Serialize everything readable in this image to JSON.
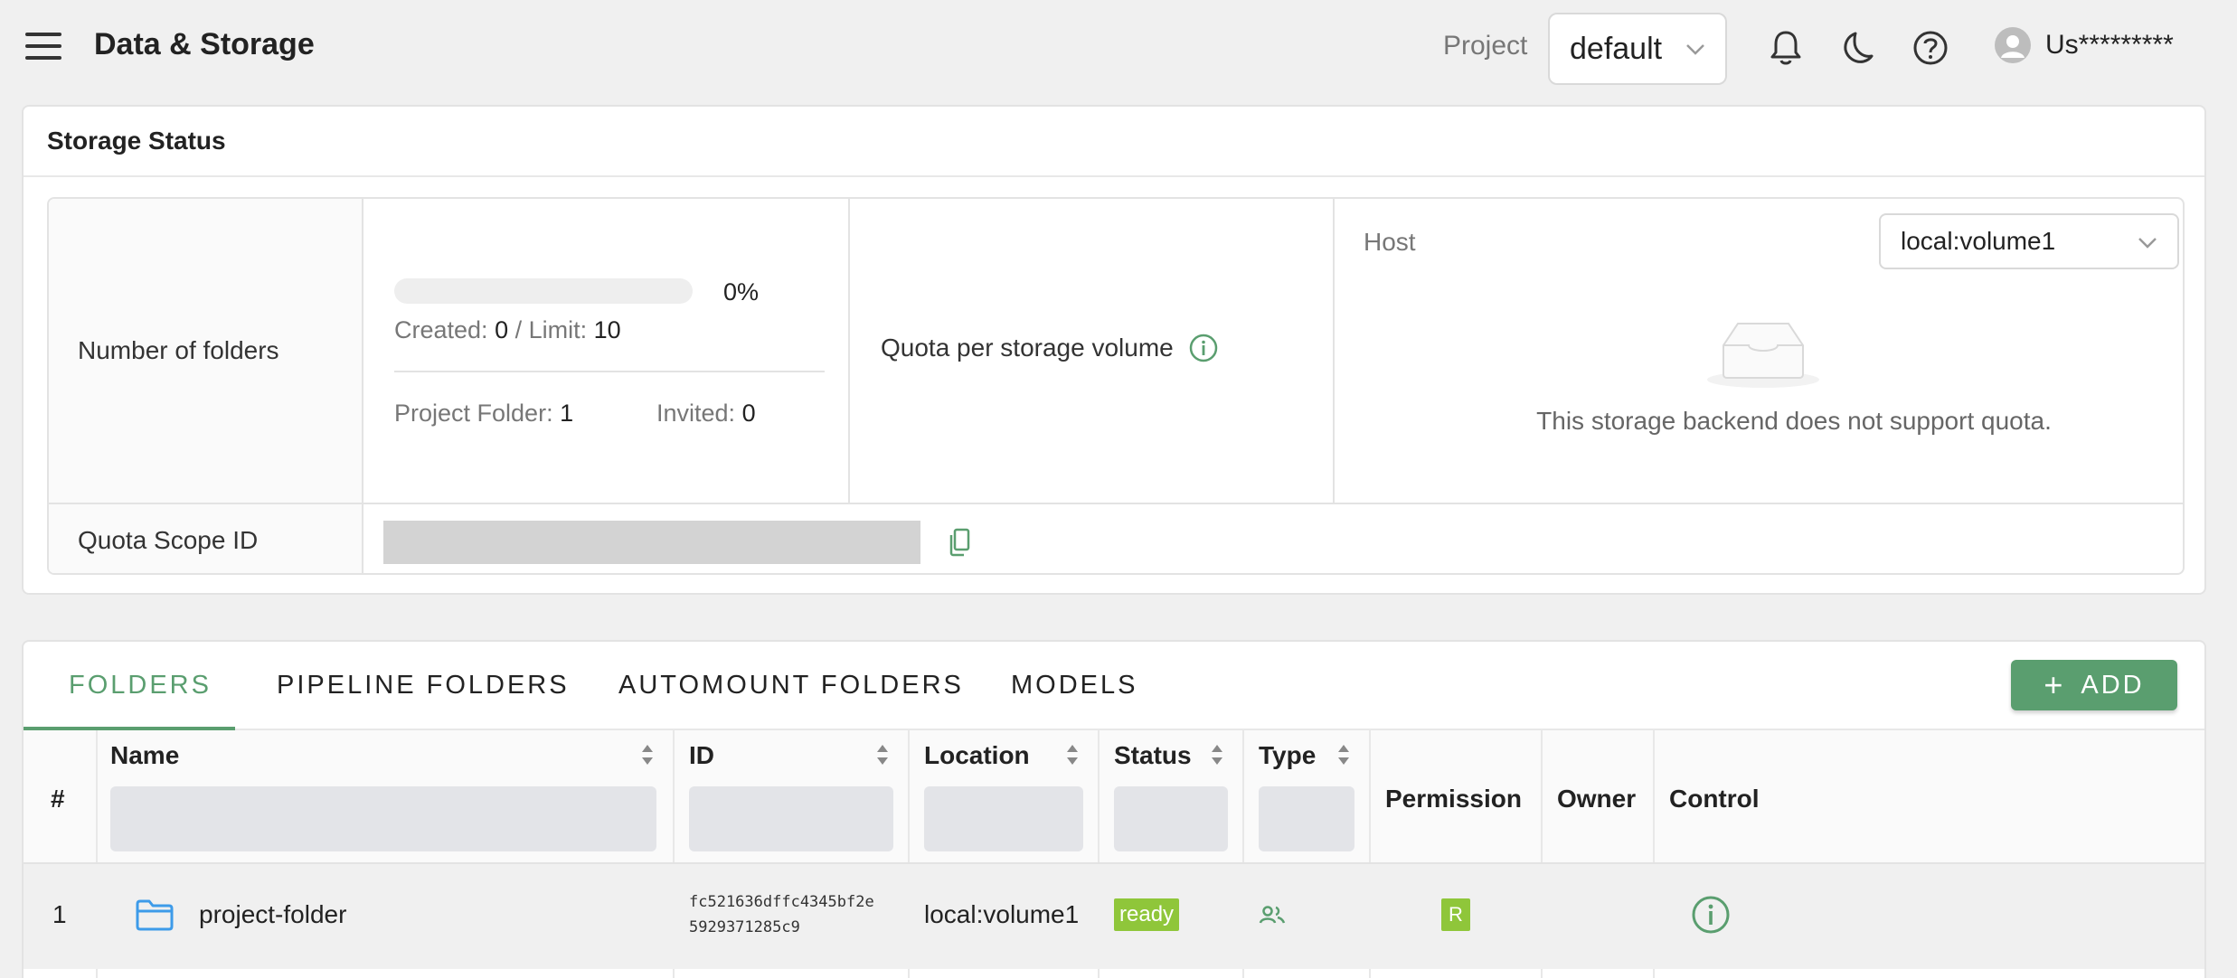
{
  "header": {
    "title": "Data & Storage",
    "project_label": "Project",
    "project_value": "default",
    "user_name": "Us*********"
  },
  "storage_status": {
    "title": "Storage Status",
    "folders": {
      "label": "Number of folders",
      "usage_percent": "0%",
      "usage_fraction": 0,
      "created_label": "Created:",
      "created_value": "0",
      "limit_label": "/ Limit:",
      "limit_value": "10",
      "project_folder_label": "Project Folder:",
      "project_folder_value": "1",
      "invited_label": "Invited:",
      "invited_value": "0"
    },
    "quota": {
      "label": "Quota per storage volume",
      "host_label": "Host",
      "host_value": "local:volume1",
      "empty_text": "This storage backend does not support quota."
    },
    "quota_scope_label": "Quota Scope ID"
  },
  "folders": {
    "tabs": [
      "FOLDERS",
      "PIPELINE FOLDERS",
      "AUTOMOUNT FOLDERS",
      "MODELS"
    ],
    "add_label": "ADD",
    "columns": {
      "index": "#",
      "name": "Name",
      "id": "ID",
      "location": "Location",
      "status": "Status",
      "type": "Type",
      "permission": "Permission",
      "owner": "Owner",
      "control": "Control"
    },
    "rows": [
      {
        "index": "1",
        "name": "project-folder",
        "id_line1": "fc521636dffc4345bf2e",
        "id_line2": "5929371285c9",
        "location": "local:volume1",
        "status": "ready",
        "permission": "R"
      }
    ]
  },
  "colors": {
    "accent": "#5a9e6f",
    "status_badge": "#8fc63a",
    "folder_icon": "#3d9be9"
  }
}
